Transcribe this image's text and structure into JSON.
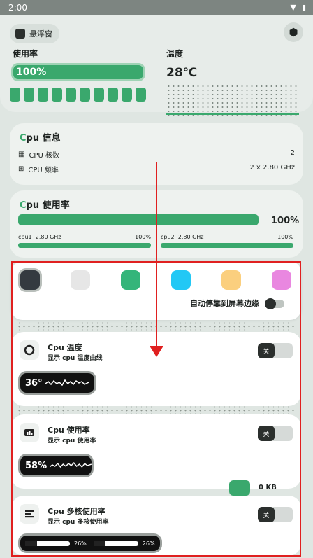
{
  "status_bar": {
    "time": "2:00"
  },
  "top": {
    "float_label": "悬浮窗",
    "usage_label": "使用率",
    "usage_value": "100%",
    "temp_label": "温度",
    "temp_value": "28℃",
    "usage_fraction": 1.0
  },
  "cpu_info": {
    "title_prefix": "C",
    "title_rest": "pu 信息",
    "rows": [
      {
        "label": "CPU 核数",
        "value": "2"
      },
      {
        "label": "CPU 频率",
        "value": "2 x 2.80 GHz"
      }
    ]
  },
  "cpu_usage": {
    "title_prefix": "C",
    "title_rest": "pu 使用率",
    "total": "100%",
    "cores": [
      {
        "name": "cpu1",
        "freq": "2.80 GHz",
        "pct": "100%"
      },
      {
        "name": "cpu2",
        "freq": "2.80 GHz",
        "pct": "100%"
      }
    ]
  },
  "picker": {
    "colors": [
      "#343a40",
      "#e6e6e6",
      "#34b57a",
      "#22c8f5",
      "#fbcf7e",
      "#e987e0"
    ],
    "selected_index": 0,
    "auto_dock_label": "自动停靠到屏幕边缘"
  },
  "modules": [
    {
      "title": "Cpu 温度",
      "subtitle": "显示 cpu 温度曲线",
      "switch_label": "关",
      "preview": "36°"
    },
    {
      "title": "Cpu 使用率",
      "subtitle": "显示 cpu 使用率",
      "switch_label": "关",
      "preview": "58%"
    },
    {
      "title": "Cpu 多核使用率",
      "subtitle": "显示 cpu 多核使用率",
      "switch_label": "关",
      "cores": [
        {
          "pct": "26%",
          "fraction": 0.26
        },
        {
          "pct": "26%",
          "fraction": 0.26
        }
      ]
    }
  ],
  "net": {
    "value": "0 KB"
  }
}
